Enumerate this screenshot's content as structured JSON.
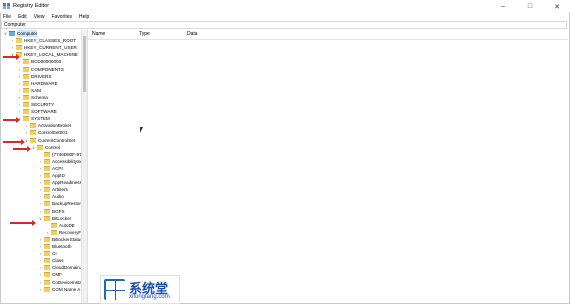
{
  "window": {
    "title": "Registry Editor"
  },
  "menu": [
    "File",
    "Edit",
    "View",
    "Favorites",
    "Help"
  ],
  "address": "Computer",
  "columns": {
    "name": "Name",
    "type": "Type",
    "data": "Data"
  },
  "tree": [
    {
      "label": "Computer",
      "depth": 0,
      "exp": "v",
      "selected": true
    },
    {
      "label": "HKEY_CLASSES_ROOT",
      "depth": 1,
      "exp": ">"
    },
    {
      "label": "HKEY_CURRENT_USER",
      "depth": 1,
      "exp": ">"
    },
    {
      "label": "HKEY_LOCAL_MACHINE",
      "depth": 1,
      "exp": "v"
    },
    {
      "label": "BCD00000000",
      "depth": 2,
      "exp": ">"
    },
    {
      "label": "COMPONENTS",
      "depth": 2,
      "exp": ">"
    },
    {
      "label": "DRIVERS",
      "depth": 2,
      "exp": ">"
    },
    {
      "label": "HARDWARE",
      "depth": 2,
      "exp": ">"
    },
    {
      "label": "SAM",
      "depth": 2,
      "exp": ">"
    },
    {
      "label": "Schema",
      "depth": 2,
      "exp": ">"
    },
    {
      "label": "SECURITY",
      "depth": 2,
      "exp": ">"
    },
    {
      "label": "SOFTWARE",
      "depth": 2,
      "exp": ">"
    },
    {
      "label": "SYSTEM",
      "depth": 2,
      "exp": "v"
    },
    {
      "label": "ActivationBroker",
      "depth": 3,
      "exp": ">"
    },
    {
      "label": "ControlSet001",
      "depth": 3,
      "exp": ">"
    },
    {
      "label": "CurrentControlSet",
      "depth": 3,
      "exp": "v"
    },
    {
      "label": "Control",
      "depth": 4,
      "exp": "v"
    },
    {
      "label": "{7746D80F-97E",
      "depth": 5,
      "exp": ""
    },
    {
      "label": "AccessibilitySe",
      "depth": 5,
      "exp": ">"
    },
    {
      "label": "ACPI",
      "depth": 5,
      "exp": ">"
    },
    {
      "label": "AppID",
      "depth": 5,
      "exp": ">"
    },
    {
      "label": "AppReadiness",
      "depth": 5,
      "exp": ">"
    },
    {
      "label": "Arbiters",
      "depth": 5,
      "exp": ">"
    },
    {
      "label": "Audio",
      "depth": 5,
      "exp": ">"
    },
    {
      "label": "BackupRestore",
      "depth": 5,
      "exp": ">"
    },
    {
      "label": "BGFX",
      "depth": 5,
      "exp": ">"
    },
    {
      "label": "BitLocker",
      "depth": 5,
      "exp": "v"
    },
    {
      "label": "AutoDE",
      "depth": 6,
      "exp": ""
    },
    {
      "label": "RecoveryFi",
      "depth": 6,
      "exp": ">"
    },
    {
      "label": "BitlockerStatus",
      "depth": 5,
      "exp": ">"
    },
    {
      "label": "Bluetooth",
      "depth": 5,
      "exp": ">"
    },
    {
      "label": "CI",
      "depth": 5,
      "exp": ">"
    },
    {
      "label": "Class",
      "depth": 5,
      "exp": ">"
    },
    {
      "label": "CloudDomainJ",
      "depth": 5,
      "exp": ">"
    },
    {
      "label": "CMF",
      "depth": 5,
      "exp": ">"
    },
    {
      "label": "CoDeviceInsta",
      "depth": 5,
      "exp": ">"
    },
    {
      "label": "COM Name A",
      "depth": 5,
      "exp": ">"
    }
  ],
  "watermark": {
    "text_cn": "系统堂",
    "url": "xitongtang.com"
  },
  "colors": {
    "folder": "#f2cd5f",
    "arrow": "#d42a2a",
    "selection": "#cce4f7",
    "brand": "#1b4fb0"
  }
}
